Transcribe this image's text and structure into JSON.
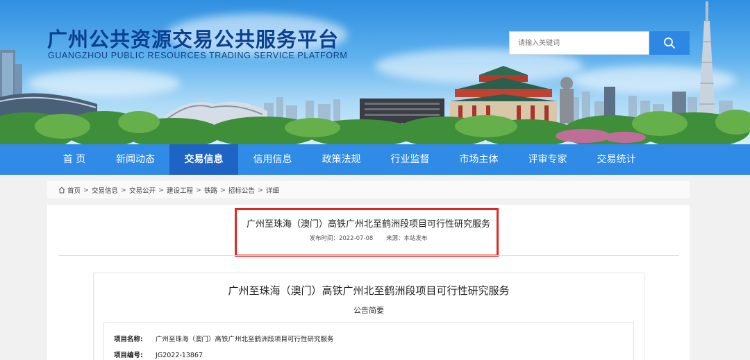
{
  "header": {
    "title_cn": "广州公共资源交易公共服务平台",
    "title_en": "GUANGZHOU PUBLIC RESOURCES TRADING SERVICE PLATFORM",
    "search_placeholder": "请输入关键词"
  },
  "nav": {
    "items": [
      {
        "label": "首 页"
      },
      {
        "label": "新闻动态"
      },
      {
        "label": "交易信息"
      },
      {
        "label": "信用信息"
      },
      {
        "label": "政策法规"
      },
      {
        "label": "行业监督"
      },
      {
        "label": "市场主体"
      },
      {
        "label": "评审专家"
      },
      {
        "label": "交易统计"
      }
    ],
    "active": "交易信息"
  },
  "breadcrumb": {
    "items": [
      "首页",
      "交易信息",
      "交易公开",
      "建设工程",
      "铁路",
      "招标公告",
      "详细"
    ],
    "separator": ">"
  },
  "article": {
    "title": "广州至珠海（澳门）高铁广州北至鹤洲段项目可行性研究服务",
    "publish_label": "发布时间：2022-07-08",
    "source_label": "来源：本站发布"
  },
  "notice": {
    "title": "广州至珠海（澳门）高铁广州北至鹤洲段项目可行性研究服务",
    "subtitle": "公告简要",
    "rows": [
      {
        "label": "项目名称:",
        "value": "广州至珠海（澳门）高铁广州北至鹤洲段项目可行性研究服务"
      },
      {
        "label": "项目编号:",
        "value": "JG2022-13867"
      }
    ]
  },
  "colors": {
    "nav_bg": "#2f8be6",
    "nav_active": "#1d64c4",
    "title_blue": "#0b3f8f",
    "highlight_red": "#e12626",
    "search_btn": "#2f87e4"
  }
}
